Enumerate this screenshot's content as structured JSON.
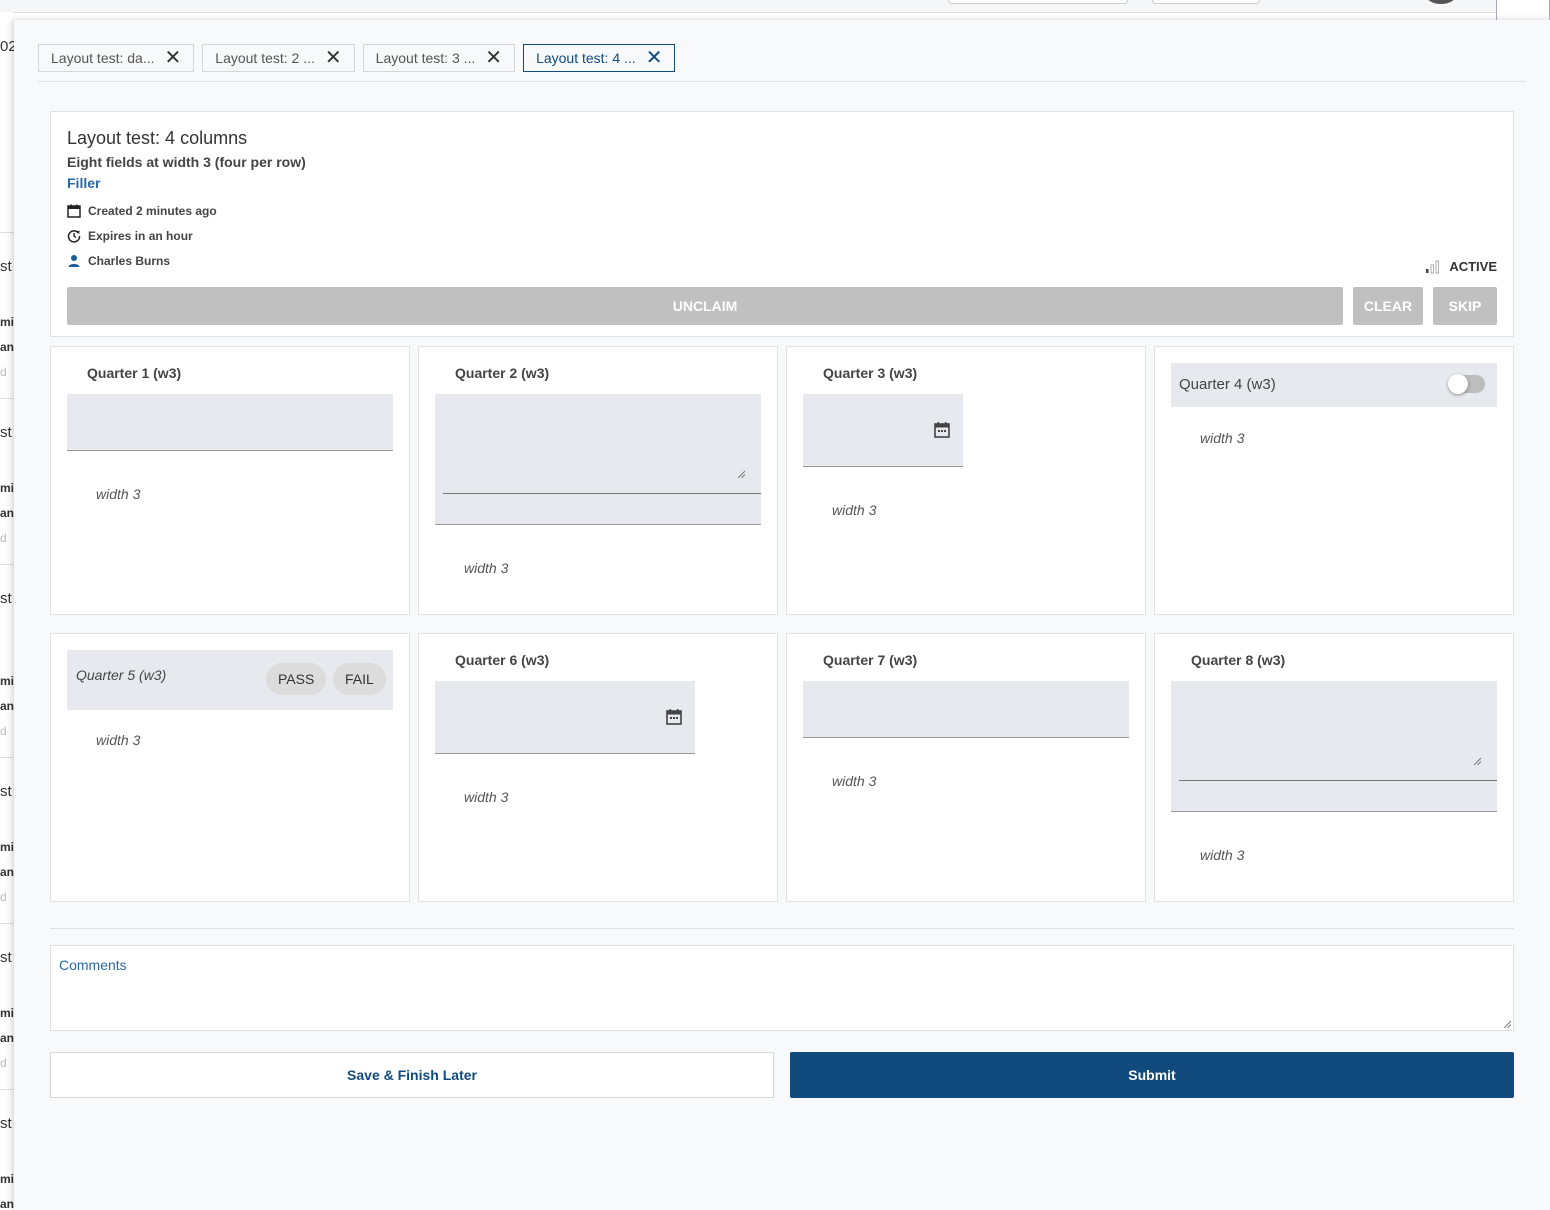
{
  "tabs": [
    {
      "label": "Layout test: da..."
    },
    {
      "label": "Layout test: 2 ..."
    },
    {
      "label": "Layout test: 3 ..."
    },
    {
      "label": "Layout test: 4 ..."
    }
  ],
  "task": {
    "title": "Layout test: 4 columns",
    "subtitle": "Eight fields at width 3 (four per row)",
    "type_label": "Filler",
    "created": "Created 2 minutes ago",
    "expires": "Expires in an hour",
    "assignee": "Charles Burns",
    "status": "ACTIVE"
  },
  "actions": {
    "unclaim": "UNCLAIM",
    "clear": "CLEAR",
    "skip": "SKIP"
  },
  "fields": [
    {
      "label": "Quarter 1 (w3)",
      "help": "width 3",
      "kind": "text"
    },
    {
      "label": "Quarter 2 (w3)",
      "help": "width 3",
      "kind": "textarea"
    },
    {
      "label": "Quarter 3 (w3)",
      "help": "width 3",
      "kind": "date"
    },
    {
      "label": "Quarter 4 (w3)",
      "help": "width 3",
      "kind": "toggle"
    },
    {
      "label": "Quarter 5 (w3)",
      "help": "width 3",
      "kind": "pass-fail",
      "options": [
        "PASS",
        "FAIL"
      ]
    },
    {
      "label": "Quarter 6 (w3)",
      "help": "width 3",
      "kind": "date"
    },
    {
      "label": "Quarter 7 (w3)",
      "help": "width 3",
      "kind": "text"
    },
    {
      "label": "Quarter 8 (w3)",
      "help": "width 3",
      "kind": "textarea"
    }
  ],
  "comments": {
    "label": "Comments"
  },
  "footer": {
    "save_label": "Save & Finish Later",
    "submit_label": "Submit"
  },
  "background": {
    "fragments": [
      "02",
      "st",
      "mi",
      "an",
      "d"
    ]
  },
  "colors": {
    "primary": "#114a7d",
    "link": "#2868a8",
    "field_bg": "#e8e9ee",
    "disabled_button": "#c0c0c0"
  }
}
